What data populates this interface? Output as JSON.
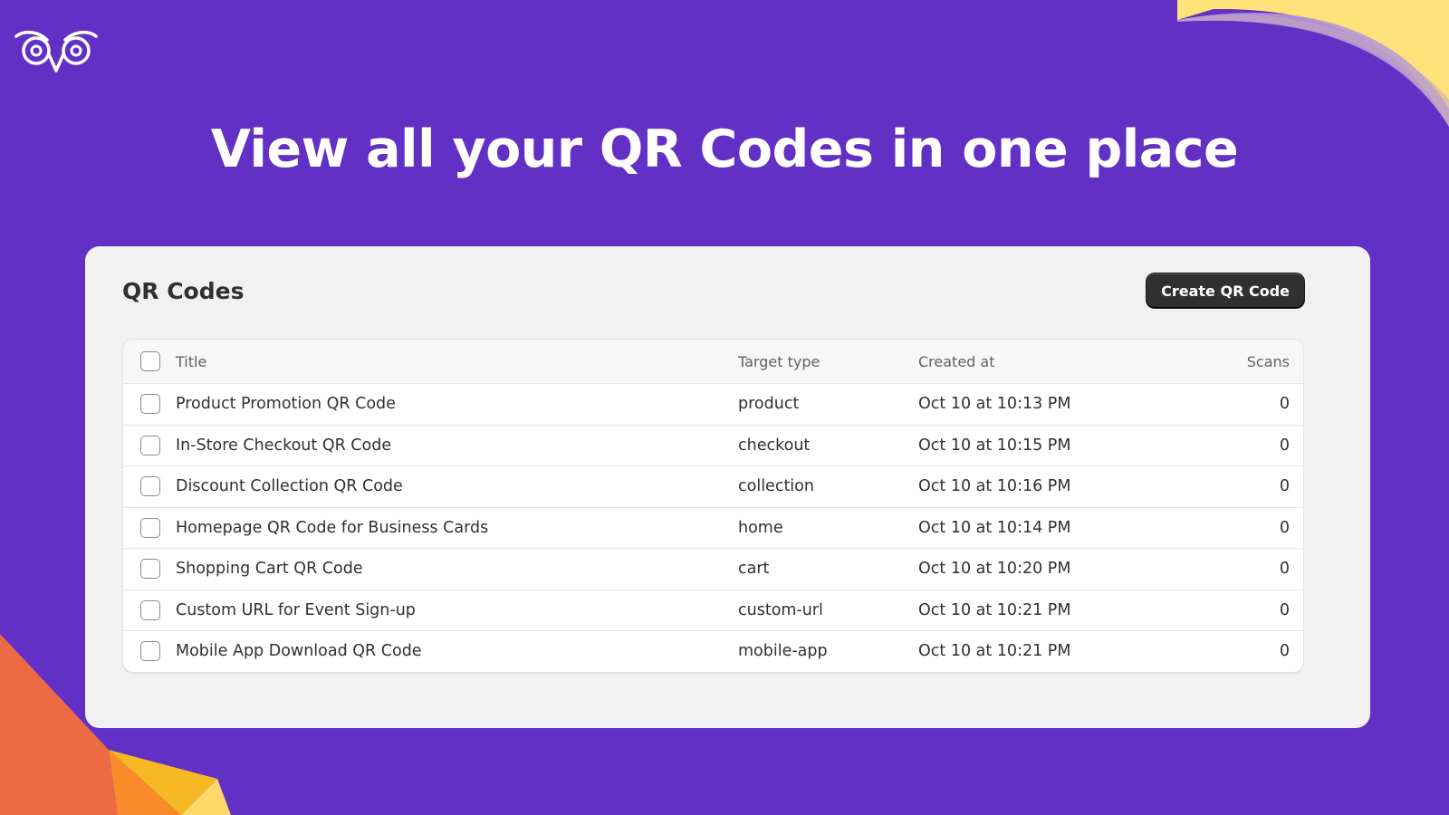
{
  "headline": "View all your QR Codes in one place",
  "panel": {
    "title": "QR Codes",
    "create_button_label": "Create QR Code"
  },
  "table": {
    "headers": {
      "title": "Title",
      "target_type": "Target type",
      "created_at": "Created at",
      "scans": "Scans"
    },
    "rows": [
      {
        "title": "Product Promotion QR Code",
        "target_type": "product",
        "created_at": "Oct 10 at 10:13 PM",
        "scans": "0"
      },
      {
        "title": "In-Store Checkout QR Code",
        "target_type": "checkout",
        "created_at": "Oct 10 at 10:15 PM",
        "scans": "0"
      },
      {
        "title": "Discount Collection QR Code",
        "target_type": "collection",
        "created_at": "Oct 10 at 10:16 PM",
        "scans": "0"
      },
      {
        "title": "Homepage QR Code for Business Cards",
        "target_type": "home",
        "created_at": "Oct 10 at 10:14 PM",
        "scans": "0"
      },
      {
        "title": "Shopping Cart QR Code",
        "target_type": "cart",
        "created_at": "Oct 10 at 10:20 PM",
        "scans": "0"
      },
      {
        "title": "Custom URL for Event Sign-up",
        "target_type": "custom-url",
        "created_at": "Oct 10 at 10:21 PM",
        "scans": "0"
      },
      {
        "title": "Mobile App Download QR Code",
        "target_type": "mobile-app",
        "created_at": "Oct 10 at 10:21 PM",
        "scans": "0"
      }
    ]
  },
  "icons": {
    "logo": "owl-eyes-logo-icon",
    "select": "checkbox-icon"
  },
  "colors": {
    "background": "#6330c6",
    "panel": "#f1f1f1",
    "button": "#303030",
    "accent_yellow": "#ffe27a",
    "accent_orange": "#f07a3a"
  }
}
